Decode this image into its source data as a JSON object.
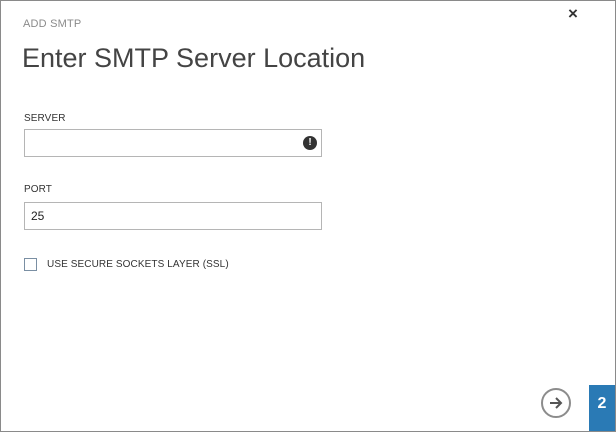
{
  "dialog": {
    "small_title": "ADD SMTP",
    "main_title": "Enter SMTP Server Location",
    "close_label": "×"
  },
  "server": {
    "label": "SERVER",
    "value": "",
    "error_glyph": "!"
  },
  "port": {
    "label": "PORT",
    "value": "25"
  },
  "ssl": {
    "label": "USE SECURE SOCKETS LAYER (SSL)",
    "checked": false
  },
  "wizard": {
    "step_number": "2",
    "accent_color": "#2a7ab5"
  }
}
